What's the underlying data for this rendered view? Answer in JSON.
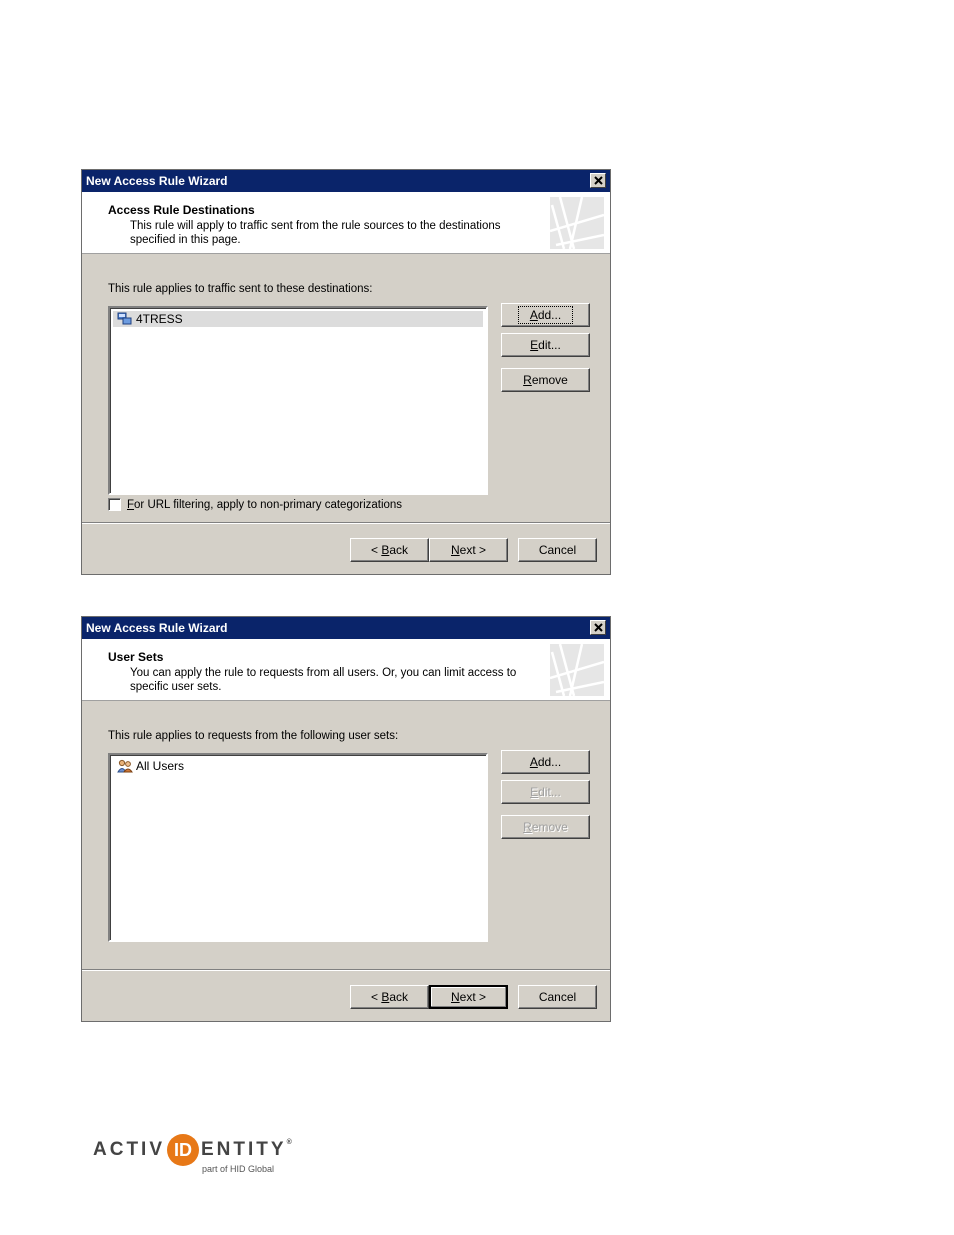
{
  "dialogs": [
    {
      "title": "New Access Rule Wizard",
      "header_title": "Access Rule Destinations",
      "header_desc": "This rule will apply to traffic sent from the rule sources to the destinations specified in this page.",
      "list_label": "This rule applies to traffic sent to these destinations:",
      "items": [
        "4TRESS"
      ],
      "buttons": {
        "add": "Add...",
        "edit": "Edit...",
        "remove": "Remove"
      },
      "checkbox_label": "For URL filtering, apply to non-primary categorizations",
      "nav": {
        "back": "< Back",
        "next": "Next >",
        "cancel": "Cancel"
      }
    },
    {
      "title": "New Access Rule Wizard",
      "header_title": "User Sets",
      "header_desc": "You can apply the rule to requests from all users. Or, you can limit access to specific user sets.",
      "list_label": "This rule applies to requests from the following user sets:",
      "items": [
        "All Users"
      ],
      "buttons": {
        "add": "Add...",
        "edit": "Edit...",
        "remove": "Remove"
      },
      "nav": {
        "back": "< Back",
        "next": "Next >",
        "cancel": "Cancel"
      }
    }
  ],
  "brand": {
    "prefix": "ACTIV",
    "badge": "ID",
    "suffix": "ENTITY",
    "registered": "®",
    "tagline": "part of HID Global"
  },
  "colors": {
    "titlebar": "#0a246a",
    "dialog_bg": "#d4d0c8",
    "brand_orange": "#e77817"
  },
  "icons": [
    "close-icon",
    "wizard-header-graphic",
    "network-destination-icon",
    "user-set-icon"
  ]
}
